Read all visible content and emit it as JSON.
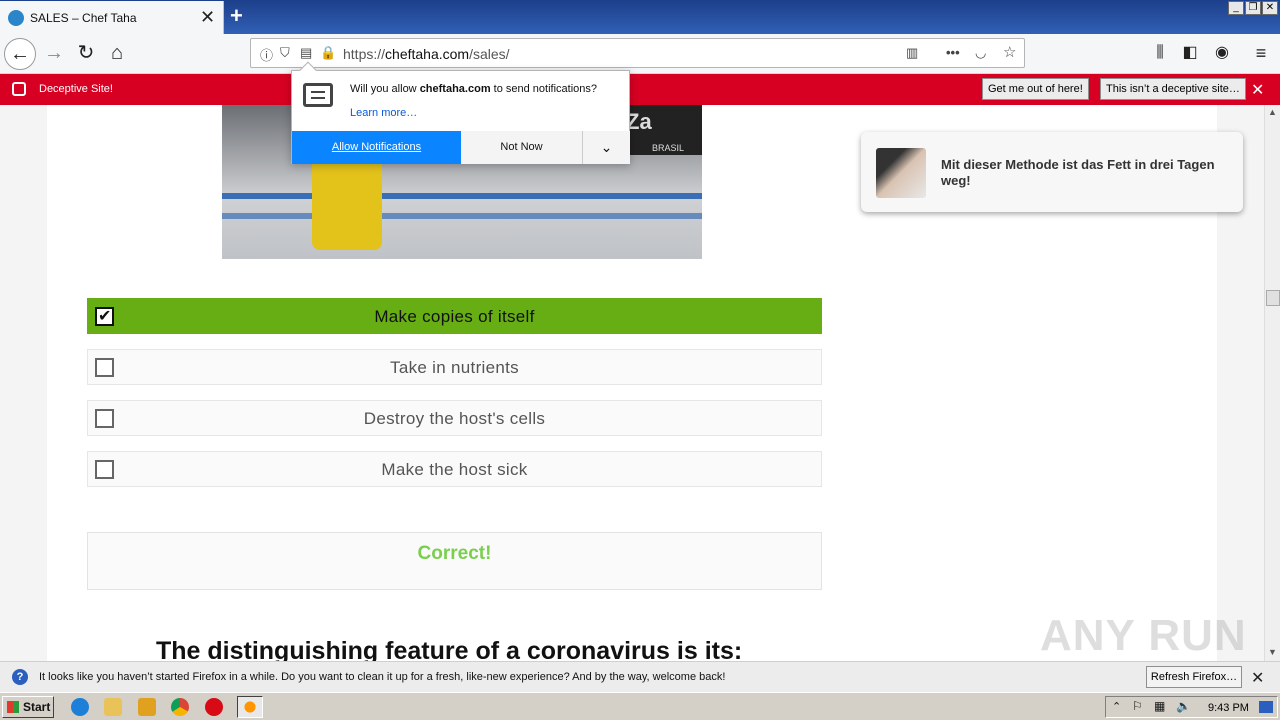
{
  "browser": {
    "tab_title": "SALES – Chef Taha",
    "url_prefix": "https://",
    "url_domain": "cheftaha.com",
    "url_path": "/sales/"
  },
  "deceptive_bar": {
    "label": "Deceptive Site!",
    "get_out_button": "Get me out of here!",
    "not_deceptive_button": "This isn’t a deceptive site…"
  },
  "notification_popup": {
    "message_prefix": "Will you allow ",
    "message_domain": "cheftaha.com",
    "message_suffix": " to send notifications?",
    "learn_more": "Learn more…",
    "allow_button": "Allow Notifications",
    "not_now_button": "Not Now"
  },
  "photo": {
    "sign_text": "Za",
    "sign_sub": "BRASIL"
  },
  "quiz": {
    "options": [
      {
        "label": "Make copies of itself",
        "checked": true
      },
      {
        "label": "Take in nutrients",
        "checked": false
      },
      {
        "label": "Destroy the host's cells",
        "checked": false
      },
      {
        "label": "Make the host sick",
        "checked": false
      }
    ],
    "result": "Correct!",
    "next_question": "The distinguishing feature of a coronavirus is its:"
  },
  "ad_card": {
    "text": "Mit dieser Methode ist das Fett in drei Tagen weg!"
  },
  "watermark": "ANY RUN",
  "bottom_bar": {
    "message": "It looks like you haven’t started Firefox in a while. Do you want to clean it up for a fresh, like-new experience? And by the way, welcome back!",
    "refresh_button": "Refresh Firefox…"
  },
  "taskbar": {
    "start_label": "Start",
    "clock": "9:43 PM"
  },
  "colors": {
    "deceptive_red": "#d70022",
    "correct_green": "#67ae15",
    "allow_blue": "#0a84ff"
  }
}
